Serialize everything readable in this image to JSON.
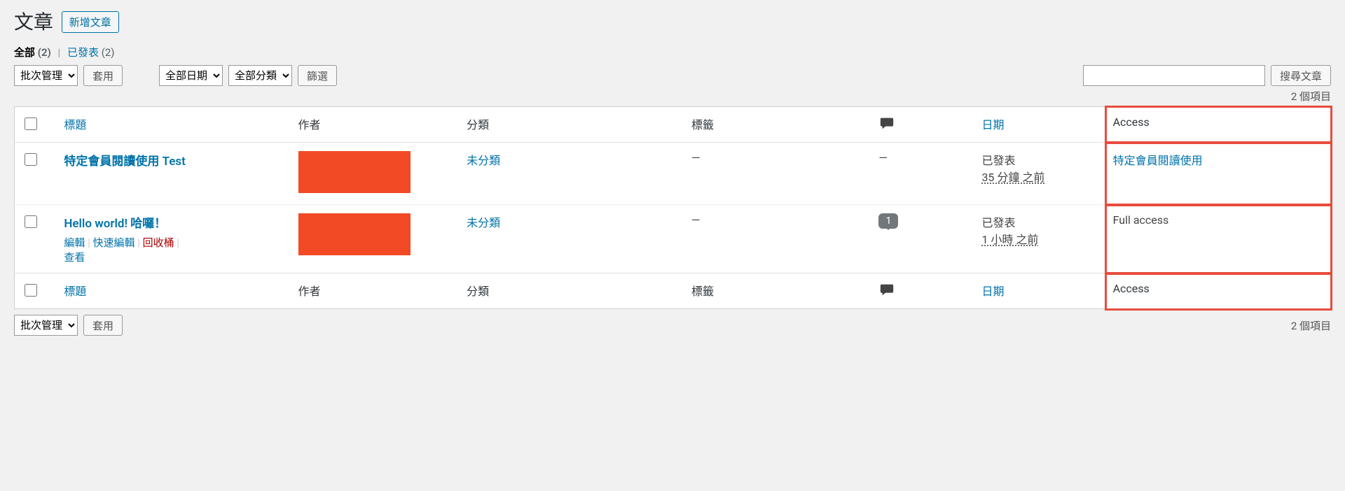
{
  "heading": "文章",
  "add_new_label": "新增文章",
  "filters": {
    "all_label": "全部",
    "all_count": "(2)",
    "published_label": "已發表",
    "published_count": "(2)"
  },
  "bulk_select": "批次管理",
  "apply_label": "套用",
  "date_select": "全部日期",
  "cat_select": "全部分類",
  "filter_label": "篩選",
  "search_button": "搜尋文章",
  "item_count": "2 個項目",
  "cols": {
    "title": "標題",
    "author": "作者",
    "category": "分類",
    "tags": "標籤",
    "date": "日期",
    "access": "Access"
  },
  "rows": [
    {
      "title": "特定會員閱讀使用 Test",
      "category": "未分類",
      "tags": "—",
      "comments_display": "—",
      "comments_count": "",
      "date_status": "已發表",
      "date_ago": "35 分鐘 之前",
      "access": "特定會員閱讀使用",
      "access_link": true,
      "show_actions": false
    },
    {
      "title": "Hello world! 哈囉！",
      "category": "未分類",
      "tags": "—",
      "comments_display": "",
      "comments_count": "1",
      "date_status": "已發表",
      "date_ago": "1 小時 之前",
      "access": "Full access",
      "access_link": false,
      "show_actions": true
    }
  ],
  "row_actions": {
    "edit": "編輯",
    "quick_edit": "快速編輯",
    "trash": "回收桶",
    "view": "查看"
  }
}
